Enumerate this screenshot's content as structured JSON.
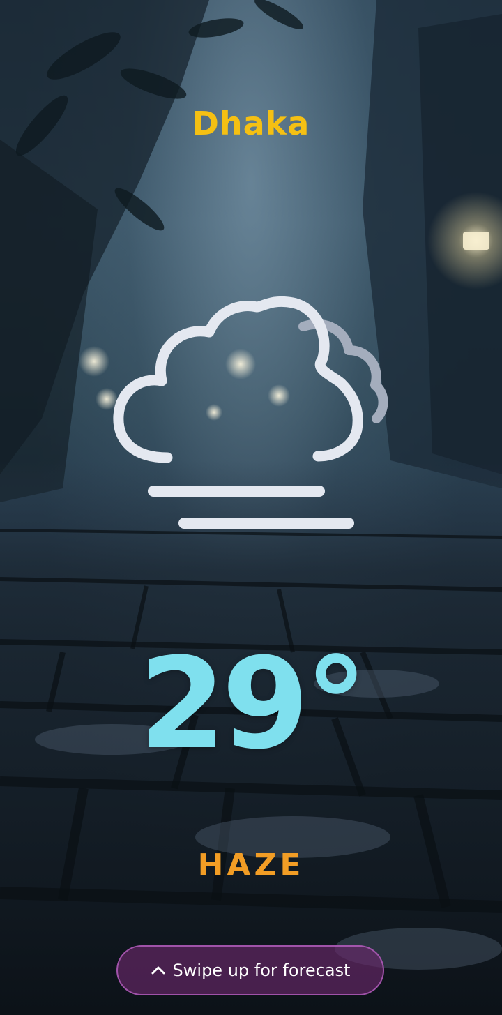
{
  "location": {
    "city": "Dhaka"
  },
  "current": {
    "icon": "haze-icon",
    "temperature": "29°",
    "condition": "HAZE"
  },
  "footer": {
    "swipe_icon": "chevron-up-icon",
    "swipe_label": "Swipe up for forecast"
  },
  "colors": {
    "city": "#f5c013",
    "temperature": "#7fe0ee",
    "condition": "#f29d25",
    "icon_stroke": "#e4e8f0",
    "button_bg": "#6e286e"
  }
}
